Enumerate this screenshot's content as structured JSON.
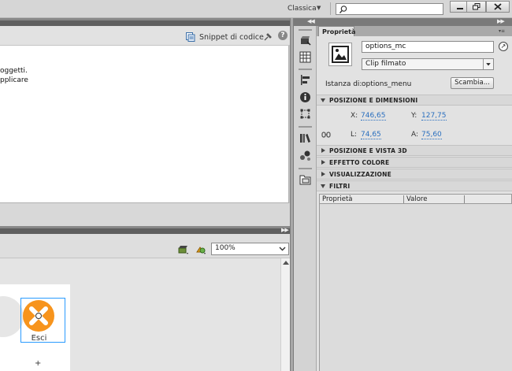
{
  "topbar": {
    "workspace": "Classica",
    "search_placeholder": ""
  },
  "editor": {
    "snippets_label": "Snippet di codice",
    "help_glyph": "?",
    "line1": "oggetti.",
    "line2": "pplicare"
  },
  "stage": {
    "zoom": "100%",
    "exit_label": "Esci",
    "registration_mark": "+"
  },
  "properties": {
    "tab_label": "Proprietà",
    "instance_name": "options_mc",
    "symbol_type": "Clip filmato",
    "instance_of_label": "Istanza di:",
    "instance_of_value": "options_menu",
    "swap_button": "Scambia...",
    "sections": {
      "position_size": "POSIZIONE E DIMENSIONI",
      "position_3d": "POSIZIONE E VISTA 3D",
      "color_effect": "EFFETTO COLORE",
      "display": "VISUALIZZAZIONE",
      "filters": "FILTRI"
    },
    "position": {
      "x_label": "X:",
      "x_value": "746,65",
      "y_label": "Y:",
      "y_value": "127,75",
      "w_label": "L:",
      "w_value": "74,65",
      "h_label": "A:",
      "h_value": "75,60"
    },
    "filters_table": {
      "col_property": "Proprietà",
      "col_value": "Valore"
    }
  },
  "colors": {
    "accent_link": "#2a6fbf",
    "exit_orange": "#f7941d",
    "selection_blue": "#2a9bff"
  },
  "icons": {
    "search": "search-icon",
    "snippets": "code-snippets-icon",
    "exit": "close-x-icon",
    "swap": "swap-symbol-icon"
  }
}
